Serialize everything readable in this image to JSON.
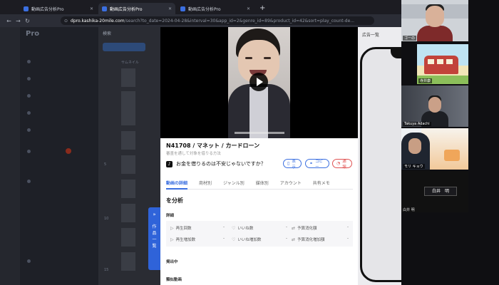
{
  "browser": {
    "tabs": [
      {
        "title": "動画広告分析Pro",
        "active": false
      },
      {
        "title": "動画広告分析Pro",
        "active": true
      },
      {
        "title": "動画広告分析Pro",
        "active": false
      }
    ],
    "new_tab": "+",
    "url_site": "dpro.kashika-20mile.com",
    "url_path": "/search?to_date=2024-04-28&interval=30&app_id=2&genre_id=89&product_id=42&sort=play_count-de..."
  },
  "app": {
    "logo": "Pro",
    "list_header": "検索",
    "col_label": "サムネイル",
    "side_toggle_label": [
      "作",
      "品",
      "一",
      "覧"
    ],
    "right_strip_label": "広告一覧",
    "row_numbers": [
      "5",
      "10",
      "15"
    ]
  },
  "modal": {
    "title": "N41708 / マネット / カードローン",
    "subtitle": "審査を通して対象を借りる方法",
    "platform_icon": "♪",
    "ad_text": "お金を借りるのは不安じゃないですか？",
    "buttons": {
      "show": "表示",
      "copy": "コピー",
      "report": "通報"
    },
    "tabs": [
      "動画の詳細",
      "商材別",
      "ジャンル別",
      "媒体別",
      "アカウント",
      "共有メモ"
    ],
    "active_tab": 0,
    "analysis_heading": "を分析",
    "details_heading": "詳細",
    "stats": [
      {
        "label": "再生回数",
        "value": "-",
        "icon": "play-icon"
      },
      {
        "label": "いいね数",
        "value": "-",
        "icon": "heart-icon"
      },
      {
        "label": "予算消化額",
        "value": "-",
        "icon": "money-icon"
      },
      {
        "label": "再生増加数",
        "value": "-",
        "icon": "play-icon"
      },
      {
        "label": "いいね増加数",
        "value": "-",
        "icon": "heart-icon"
      },
      {
        "label": "予算消化増加額",
        "value": "-",
        "icon": "money-icon"
      }
    ],
    "section_running": "掲出中",
    "section_related": "類似動画"
  },
  "call": {
    "participants": [
      {
        "name": "ゴーの",
        "view": "camera"
      },
      {
        "name": "寺井康",
        "view": "avatar"
      },
      {
        "name": "Takuya Adachi",
        "view": "camera"
      },
      {
        "name": "モリ キョウ",
        "view": "camera"
      },
      {
        "name": "白井 明",
        "view": "camera-off"
      }
    ],
    "name_box": "白井　明",
    "bottom_label": "白井 明"
  },
  "colors": {
    "accent": "#3b6fe0",
    "danger": "#e05252",
    "toggle": "#2f63d9"
  }
}
